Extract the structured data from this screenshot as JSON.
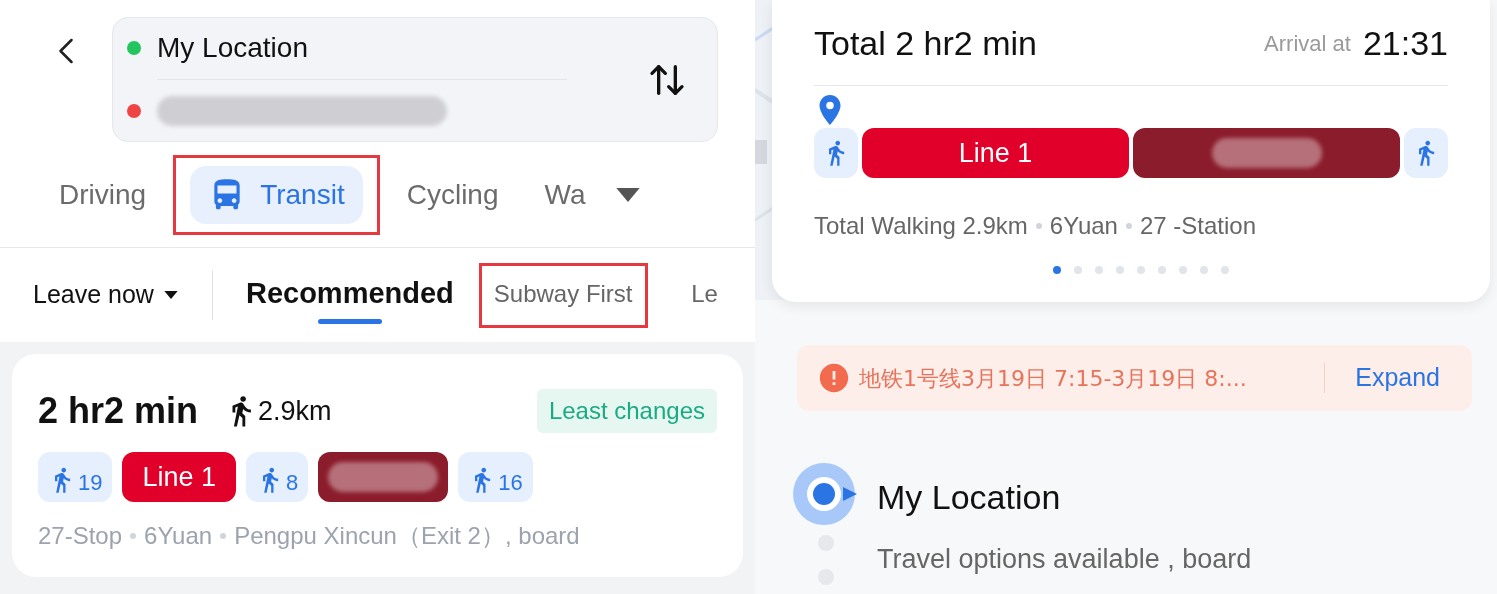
{
  "left": {
    "origin": {
      "label": "My Location",
      "color": "#22c55e"
    },
    "destination": {
      "color": "#ef4444",
      "blurred": true
    },
    "modes": [
      {
        "label": "Driving",
        "selected": false,
        "annotated": false,
        "kind": "text"
      },
      {
        "label": "Transit",
        "selected": true,
        "annotated": true,
        "kind": "bus"
      },
      {
        "label": "Cycling",
        "selected": false,
        "annotated": false,
        "kind": "text"
      },
      {
        "label": "Wa",
        "selected": false,
        "annotated": false,
        "kind": "text"
      }
    ],
    "time_filter": "Leave now",
    "sort_options": [
      {
        "label": "Recommended",
        "selected": true,
        "annotated": false
      },
      {
        "label": "Subway First",
        "selected": false,
        "annotated": true
      },
      {
        "label": "Le",
        "selected": false,
        "annotated": false
      }
    ],
    "route": {
      "duration": "2 hr2 min",
      "walking": "2.9km",
      "tag": "Least changes",
      "segments": [
        {
          "kind": "walk",
          "text": "19"
        },
        {
          "kind": "line",
          "text": "Line 1",
          "color": "#e0002a"
        },
        {
          "kind": "walk",
          "text": "8"
        },
        {
          "kind": "blurred",
          "color": "#8b1c2b"
        },
        {
          "kind": "walk",
          "text": "16"
        }
      ],
      "summary": [
        "27-Stop",
        "6Yuan",
        "Pengpu Xincun（Exit 2）, board"
      ]
    }
  },
  "right": {
    "total": "Total 2 hr2 min",
    "arrival_label": "Arrival at",
    "arrival_time": "21:31",
    "segments": [
      {
        "kind": "walk"
      },
      {
        "kind": "line",
        "text": "Line 1",
        "color": "#e0002a"
      },
      {
        "kind": "blurred",
        "color": "#8b1c2b"
      },
      {
        "kind": "walk"
      }
    ],
    "summary": [
      "Total Walking 2.9km",
      "6Yuan",
      "27 -Station"
    ],
    "pages": [
      {
        "selected": true
      },
      {
        "selected": false
      },
      {
        "selected": false
      },
      {
        "selected": false
      },
      {
        "selected": false
      },
      {
        "selected": false
      },
      {
        "selected": false
      },
      {
        "selected": false
      },
      {
        "selected": false
      }
    ],
    "alert": {
      "text": "地铁1号线3月19日 7:15-3月19日 8:...",
      "action": "Expand"
    },
    "steps": [
      {
        "title": "My Location",
        "note": "Travel options available , board"
      }
    ]
  }
}
